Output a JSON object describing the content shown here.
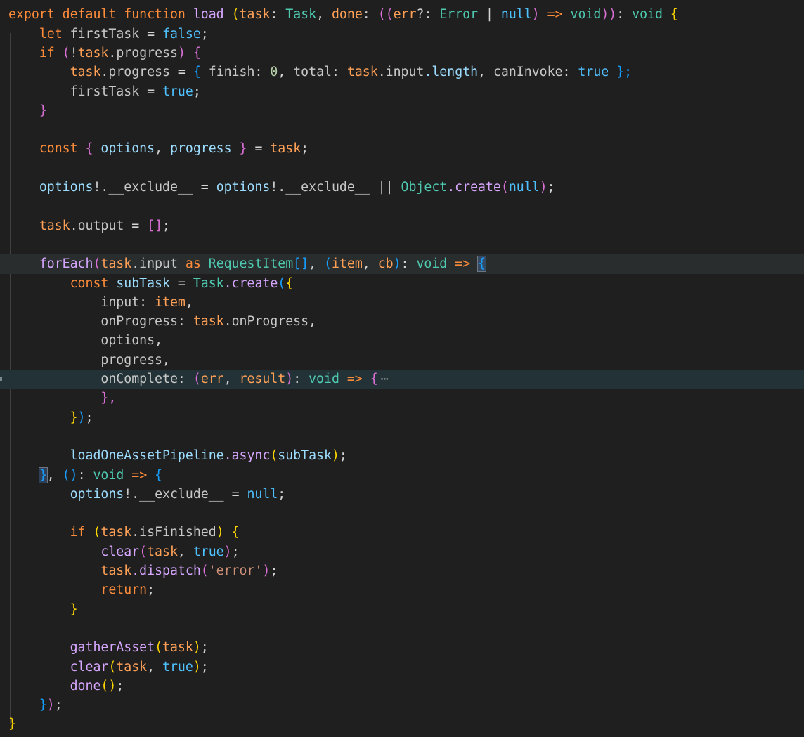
{
  "colors": {
    "bg": "#1f1f1f",
    "kw": "#ff8c3a",
    "var": "#ffa057",
    "prop": "#c8c8c8",
    "fn": "#d7a6ff",
    "type": "#4ec9b0",
    "const": "#4fc1ff",
    "num": "#b5cea8",
    "str": "#ce9178",
    "punc": "#d4d4d4",
    "b1": "#ffd700",
    "b2": "#da70d6",
    "b3": "#179fff"
  },
  "lines": [
    {
      "indent": 0,
      "tokens": [
        [
          "export default ",
          "kw"
        ],
        [
          "function ",
          "kw2"
        ],
        [
          "load",
          "fn"
        ],
        [
          " (",
          "b1"
        ],
        [
          "task",
          "var"
        ],
        [
          ": ",
          "punc"
        ],
        [
          "Task",
          "type"
        ],
        [
          ", ",
          "punc"
        ],
        [
          "done",
          "var"
        ],
        [
          ": ",
          "punc"
        ],
        [
          "((",
          "b2"
        ],
        [
          "err",
          "var"
        ],
        [
          "?: ",
          "punc"
        ],
        [
          "Error",
          "type"
        ],
        [
          " | ",
          "punc"
        ],
        [
          "null",
          "const"
        ],
        [
          ") ",
          "b2"
        ],
        [
          "=> ",
          "kw"
        ],
        [
          "void",
          "type"
        ],
        [
          "))",
          "b2"
        ],
        [
          ": ",
          "punc"
        ],
        [
          "void",
          "type"
        ],
        [
          " {",
          "b1"
        ]
      ]
    },
    {
      "indent": 1,
      "tokens": [
        [
          "let ",
          "kw"
        ],
        [
          "firstTask",
          "prop"
        ],
        [
          " = ",
          "punc"
        ],
        [
          "false",
          "const"
        ],
        [
          ";",
          "punc"
        ]
      ]
    },
    {
      "indent": 1,
      "tokens": [
        [
          "if ",
          "kw"
        ],
        [
          "(",
          "b2"
        ],
        [
          "!",
          "punc"
        ],
        [
          "task",
          "var"
        ],
        [
          ".progress",
          "prop"
        ],
        [
          ") {",
          "b2"
        ]
      ]
    },
    {
      "indent": 2,
      "tokens": [
        [
          "task",
          "var"
        ],
        [
          ".progress",
          "prop"
        ],
        [
          " = ",
          "punc"
        ],
        [
          "{ ",
          "b3"
        ],
        [
          "finish",
          "prop"
        ],
        [
          ": ",
          "punc"
        ],
        [
          "0",
          "num"
        ],
        [
          ", ",
          "punc"
        ],
        [
          "total",
          "prop"
        ],
        [
          ": ",
          "punc"
        ],
        [
          "task",
          "var"
        ],
        [
          ".input",
          "prop"
        ],
        [
          ".length",
          "const2"
        ],
        [
          ", ",
          "punc"
        ],
        [
          "canInvoke",
          "prop"
        ],
        [
          ": ",
          "punc"
        ],
        [
          "true",
          "const"
        ],
        [
          " };",
          "b3"
        ]
      ]
    },
    {
      "indent": 2,
      "tokens": [
        [
          "firstTask",
          "prop"
        ],
        [
          " = ",
          "punc"
        ],
        [
          "true",
          "const"
        ],
        [
          ";",
          "punc"
        ]
      ]
    },
    {
      "indent": 1,
      "tokens": [
        [
          "}",
          "b2"
        ]
      ]
    },
    {
      "indent": 1,
      "tokens": []
    },
    {
      "indent": 1,
      "tokens": [
        [
          "const ",
          "kw"
        ],
        [
          "{ ",
          "b2"
        ],
        [
          "options",
          "const2"
        ],
        [
          ", ",
          "punc"
        ],
        [
          "progress",
          "const2"
        ],
        [
          " }",
          "b2"
        ],
        [
          " = ",
          "punc"
        ],
        [
          "task",
          "var"
        ],
        [
          ";",
          "punc"
        ]
      ]
    },
    {
      "indent": 1,
      "tokens": []
    },
    {
      "indent": 1,
      "tokens": [
        [
          "options",
          "const2"
        ],
        [
          "!.__exclude__",
          "prop"
        ],
        [
          " = ",
          "punc"
        ],
        [
          "options",
          "const2"
        ],
        [
          "!.__exclude__",
          "prop"
        ],
        [
          " || ",
          "punc"
        ],
        [
          "Object",
          "type"
        ],
        [
          ".create",
          "fn"
        ],
        [
          "(",
          "b2"
        ],
        [
          "null",
          "const"
        ],
        [
          ")",
          "b2"
        ],
        [
          ";",
          "punc"
        ]
      ]
    },
    {
      "indent": 1,
      "tokens": []
    },
    {
      "indent": 1,
      "tokens": [
        [
          "task",
          "var"
        ],
        [
          ".output",
          "prop"
        ],
        [
          " = ",
          "punc"
        ],
        [
          "[]",
          "b2"
        ],
        [
          ";",
          "punc"
        ]
      ]
    },
    {
      "indent": 1,
      "tokens": []
    },
    {
      "indent": 1,
      "hl": true,
      "tokens": [
        [
          "forEach",
          "fn"
        ],
        [
          "(",
          "b2"
        ],
        [
          "task",
          "var"
        ],
        [
          ".input",
          "prop"
        ],
        [
          " as ",
          "kw2"
        ],
        [
          "RequestItem",
          "type"
        ],
        [
          "[]",
          "b3"
        ],
        [
          ", ",
          "punc"
        ],
        [
          "(",
          "b3"
        ],
        [
          "item",
          "var"
        ],
        [
          ", ",
          "punc"
        ],
        [
          "cb",
          "var"
        ],
        [
          ")",
          "b3"
        ],
        [
          ": ",
          "punc"
        ],
        [
          "void",
          "type"
        ],
        [
          " => ",
          "kw"
        ],
        [
          "{",
          "b3box"
        ]
      ]
    },
    {
      "indent": 2,
      "tokens": [
        [
          "const ",
          "kw"
        ],
        [
          "subTask",
          "const2"
        ],
        [
          " = ",
          "punc"
        ],
        [
          "Task",
          "type"
        ],
        [
          ".create",
          "fn"
        ],
        [
          "(",
          "b3"
        ],
        [
          "{",
          "b1"
        ]
      ]
    },
    {
      "indent": 3,
      "tokens": [
        [
          "input",
          "prop"
        ],
        [
          ": ",
          "punc"
        ],
        [
          "item",
          "var"
        ],
        [
          ",",
          "punc"
        ]
      ]
    },
    {
      "indent": 3,
      "tokens": [
        [
          "onProgress",
          "prop"
        ],
        [
          ": ",
          "punc"
        ],
        [
          "task",
          "var"
        ],
        [
          ".onProgress",
          "prop"
        ],
        [
          ",",
          "punc"
        ]
      ]
    },
    {
      "indent": 3,
      "tokens": [
        [
          "options",
          "prop"
        ],
        [
          ",",
          "punc"
        ]
      ]
    },
    {
      "indent": 3,
      "tokens": [
        [
          "progress",
          "prop"
        ],
        [
          ",",
          "punc"
        ]
      ]
    },
    {
      "indent": 3,
      "cursor": true,
      "tokens": [
        [
          "onComplete",
          "prop"
        ],
        [
          ": ",
          "punc"
        ],
        [
          "(",
          "b2"
        ],
        [
          "err",
          "var"
        ],
        [
          ", ",
          "punc"
        ],
        [
          "result",
          "var"
        ],
        [
          ")",
          "b2"
        ],
        [
          ": ",
          "punc"
        ],
        [
          "void",
          "type"
        ],
        [
          " => ",
          "kw"
        ],
        [
          "{",
          "b2"
        ],
        [
          "⋯",
          "fold"
        ]
      ]
    },
    {
      "indent": 3,
      "tokens": [
        [
          "},",
          "b2"
        ]
      ]
    },
    {
      "indent": 2,
      "tokens": [
        [
          "}",
          "b1"
        ],
        [
          ")",
          "b3"
        ],
        [
          ";",
          "punc"
        ]
      ]
    },
    {
      "indent": 2,
      "tokens": []
    },
    {
      "indent": 2,
      "tokens": [
        [
          "loadOneAssetPipeline",
          "const2"
        ],
        [
          ".async",
          "fn"
        ],
        [
          "(",
          "b1"
        ],
        [
          "subTask",
          "const2"
        ],
        [
          ")",
          "b1"
        ],
        [
          ";",
          "punc"
        ]
      ]
    },
    {
      "indent": 1,
      "tokens": [
        [
          "}",
          "b3box"
        ],
        [
          ", ",
          "punc"
        ],
        [
          "()",
          "b3"
        ],
        [
          ": ",
          "punc"
        ],
        [
          "void",
          "type"
        ],
        [
          " => ",
          "kw"
        ],
        [
          "{",
          "b3"
        ]
      ]
    },
    {
      "indent": 2,
      "tokens": [
        [
          "options",
          "const2"
        ],
        [
          "!.__exclude__",
          "prop"
        ],
        [
          " = ",
          "punc"
        ],
        [
          "null",
          "const"
        ],
        [
          ";",
          "punc"
        ]
      ]
    },
    {
      "indent": 2,
      "tokens": []
    },
    {
      "indent": 2,
      "tokens": [
        [
          "if ",
          "kw"
        ],
        [
          "(",
          "b1"
        ],
        [
          "task",
          "var"
        ],
        [
          ".isFinished",
          "prop"
        ],
        [
          ") {",
          "b1"
        ]
      ]
    },
    {
      "indent": 3,
      "tokens": [
        [
          "clear",
          "fn"
        ],
        [
          "(",
          "b2"
        ],
        [
          "task",
          "var"
        ],
        [
          ", ",
          "punc"
        ],
        [
          "true",
          "const"
        ],
        [
          ")",
          "b2"
        ],
        [
          ";",
          "punc"
        ]
      ]
    },
    {
      "indent": 3,
      "tokens": [
        [
          "task",
          "var"
        ],
        [
          ".dispatch",
          "fn"
        ],
        [
          "(",
          "b2"
        ],
        [
          "'error'",
          "str"
        ],
        [
          ")",
          "b2"
        ],
        [
          ";",
          "punc"
        ]
      ]
    },
    {
      "indent": 3,
      "tokens": [
        [
          "return",
          "kw"
        ],
        [
          ";",
          "punc"
        ]
      ]
    },
    {
      "indent": 2,
      "tokens": [
        [
          "}",
          "b1"
        ]
      ]
    },
    {
      "indent": 2,
      "tokens": []
    },
    {
      "indent": 2,
      "tokens": [
        [
          "gatherAsset",
          "fn"
        ],
        [
          "(",
          "b1"
        ],
        [
          "task",
          "var"
        ],
        [
          ")",
          "b1"
        ],
        [
          ";",
          "punc"
        ]
      ]
    },
    {
      "indent": 2,
      "tokens": [
        [
          "clear",
          "fn"
        ],
        [
          "(",
          "b1"
        ],
        [
          "task",
          "var"
        ],
        [
          ", ",
          "punc"
        ],
        [
          "true",
          "const"
        ],
        [
          ")",
          "b1"
        ],
        [
          ";",
          "punc"
        ]
      ]
    },
    {
      "indent": 2,
      "tokens": [
        [
          "done",
          "fn"
        ],
        [
          "()",
          "b1"
        ],
        [
          ";",
          "punc"
        ]
      ]
    },
    {
      "indent": 1,
      "tokens": [
        [
          "}",
          "b3"
        ],
        [
          ")",
          "b2"
        ],
        [
          ";",
          "punc"
        ]
      ]
    },
    {
      "indent": 0,
      "tokens": [
        [
          "}",
          "b1"
        ]
      ]
    }
  ]
}
